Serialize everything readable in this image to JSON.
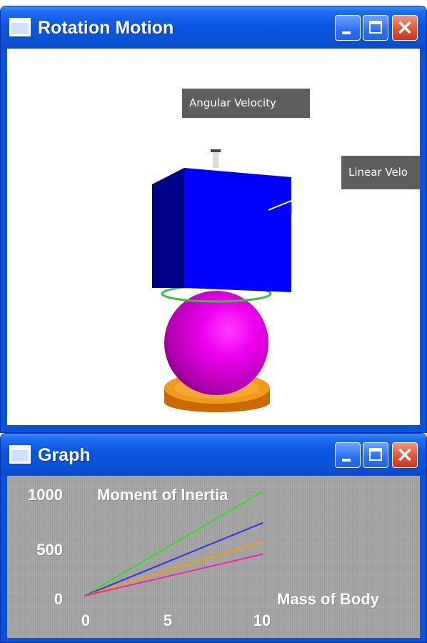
{
  "rotation_window": {
    "title": "Rotation Motion",
    "labels": {
      "angular_velocity": "Angular Velocity",
      "linear_velocity": "Linear Velo"
    }
  },
  "graph_window": {
    "title": "Graph",
    "chart_data": {
      "type": "line",
      "title": "Moment of Inertia",
      "xlabel": "Mass of Body",
      "ylabel": "",
      "xlim": [
        0,
        10
      ],
      "ylim": [
        0,
        1000
      ],
      "x_ticks": [
        "0",
        "5",
        "10"
      ],
      "y_ticks": [
        "1000",
        "500",
        "0"
      ],
      "grid": false,
      "series": [
        {
          "color": "#33dd22",
          "x": [
            0,
            10
          ],
          "y": [
            0,
            1000
          ]
        },
        {
          "color": "#3333dd",
          "x": [
            0,
            10
          ],
          "y": [
            0,
            700
          ]
        },
        {
          "color": "#ff9900",
          "x": [
            0,
            10
          ],
          "y": [
            0,
            520
          ]
        },
        {
          "color": "#ee22aa",
          "x": [
            0,
            10
          ],
          "y": [
            0,
            400
          ]
        }
      ]
    }
  }
}
